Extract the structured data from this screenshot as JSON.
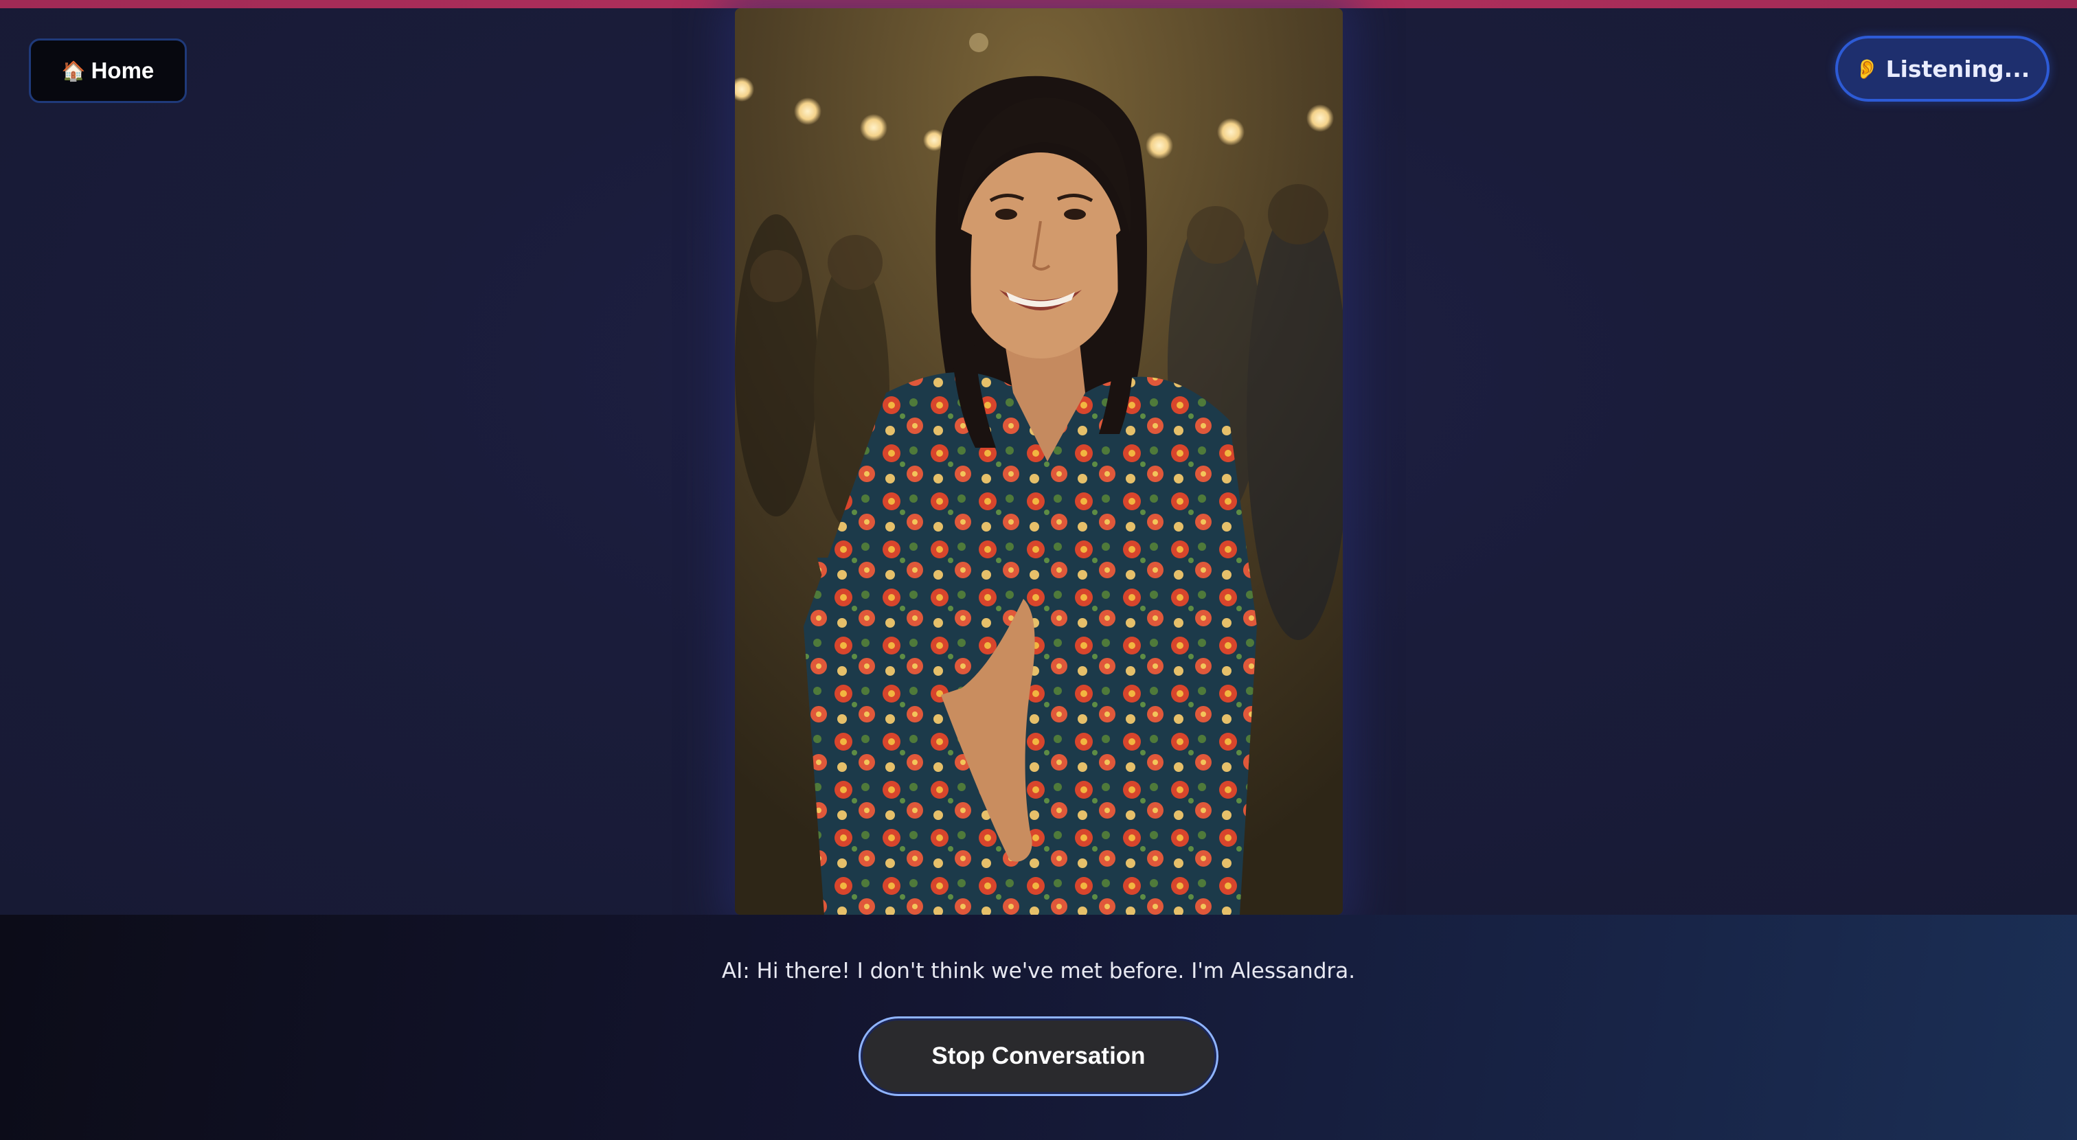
{
  "nav": {
    "home_label": "Home",
    "home_icon": "house-icon"
  },
  "status": {
    "label": "Listening...",
    "icon": "ear-icon"
  },
  "transcript": {
    "text": "AI: Hi there! I don't think we've met before. I'm Alessandra."
  },
  "controls": {
    "stop_label": "Stop Conversation"
  },
  "colors": {
    "accent_bar": "#b3305e",
    "status_border": "#2d5bd6",
    "stop_border": "#8fb4ff"
  }
}
